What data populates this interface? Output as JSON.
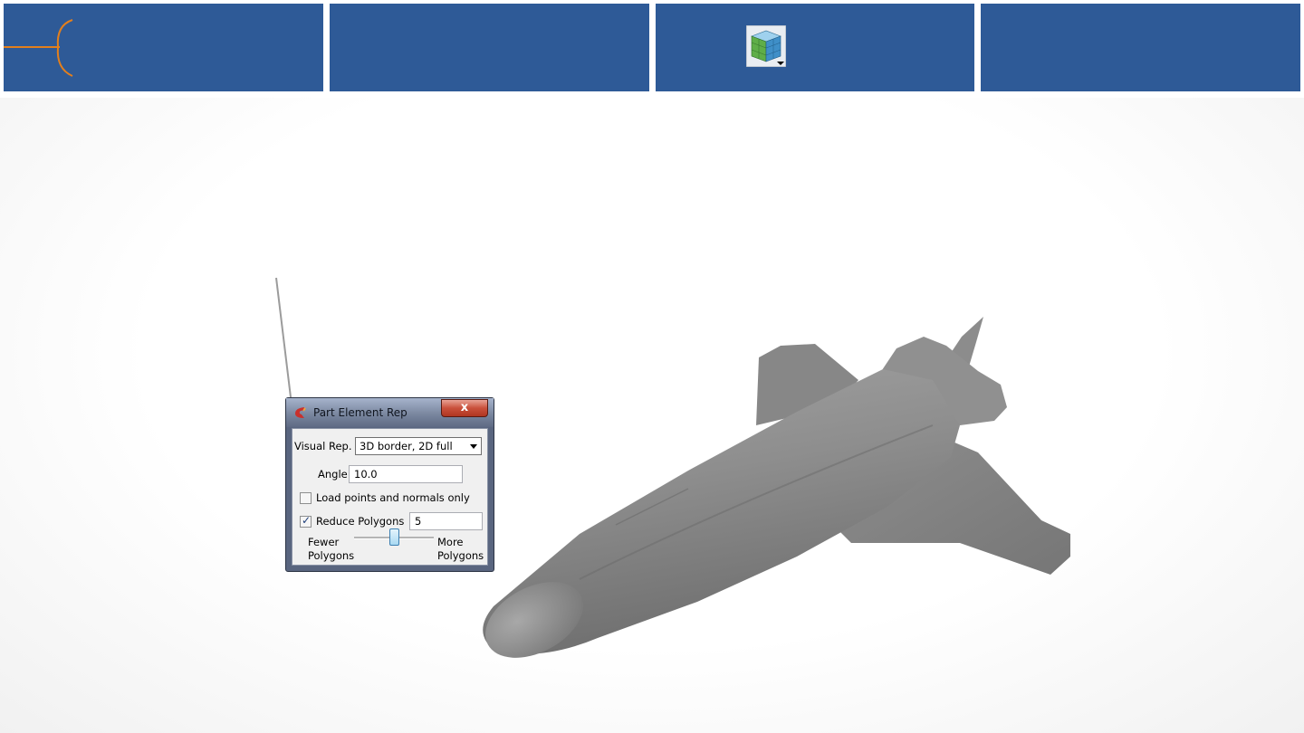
{
  "banner": {
    "accent_color": "#E37F1C",
    "background_color": "#2E5A97",
    "toolbar_icon": "part-element-rep-cube-icon"
  },
  "dialog": {
    "title": "Part Element Rep",
    "close_label": "x",
    "visual_rep_label": "Visual Rep.",
    "visual_rep_value": "3D border, 2D full",
    "angle_label": "Angle",
    "angle_value": "10.0",
    "load_points_label": "Load points and normals only",
    "load_points_checked": false,
    "reduce_polygons_label": "Reduce Polygons",
    "reduce_polygons_checked": true,
    "reduce_polygons_value": "5",
    "slider_left_line1": "Fewer",
    "slider_left_line2": "Polygons",
    "slider_right_line1": "More",
    "slider_right_line2": "Polygons",
    "slider_fraction": 0.5
  },
  "model": {
    "name": "space-shuttle-3d-model",
    "color": "#8a8a8a"
  }
}
